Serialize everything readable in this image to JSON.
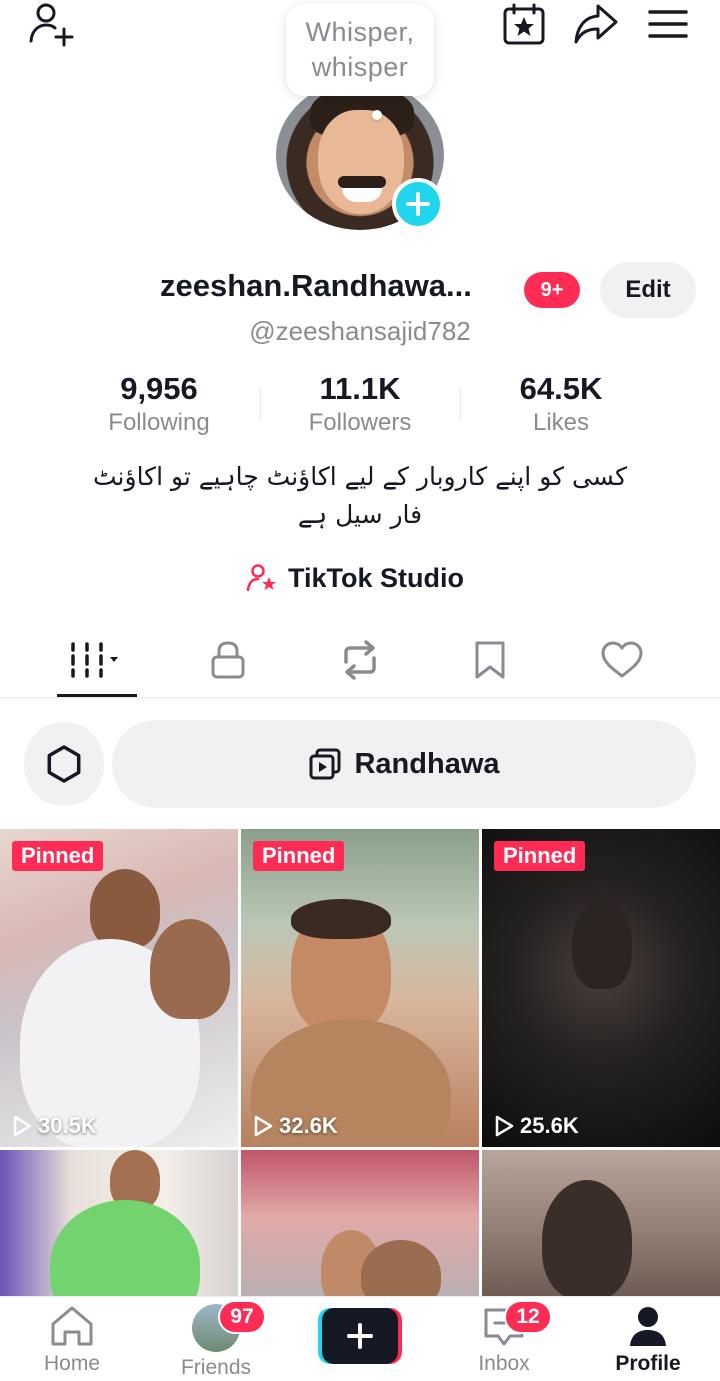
{
  "header": {
    "icons": [
      "add-friend-icon",
      "creator-calendar-icon",
      "share-icon",
      "menu-icon"
    ]
  },
  "bubble": {
    "line1": "Whisper,",
    "line2": "whisper"
  },
  "profile": {
    "display_name": "zeeshan.Randhawa...",
    "notification_badge": "9+",
    "edit_label": "Edit",
    "username": "@zeeshansajid782",
    "bio_line1": "کسی کو اپنے کاروبار کے لیے اکاؤنٹ چاہیے تو اکاؤنٹ",
    "bio_line2": "فار سیل ہے",
    "studio_label": "TikTok Studio"
  },
  "stats": {
    "following": {
      "value": "9,956",
      "label": "Following"
    },
    "followers": {
      "value": "11.1K",
      "label": "Followers"
    },
    "likes": {
      "value": "64.5K",
      "label": "Likes"
    }
  },
  "tabs": [
    "videos",
    "private",
    "reposts",
    "saved",
    "liked"
  ],
  "collection": {
    "label": "Randhawa"
  },
  "videos": [
    {
      "pinned_label": "Pinned",
      "views": "30.5K"
    },
    {
      "pinned_label": "Pinned",
      "views": "32.6K"
    },
    {
      "pinned_label": "Pinned",
      "views": "25.6K"
    },
    {
      "pinned_label": "",
      "views": ""
    },
    {
      "pinned_label": "",
      "views": ""
    },
    {
      "pinned_label": "",
      "views": ""
    }
  ],
  "bottom_nav": {
    "home": "Home",
    "friends": "Friends",
    "friends_badge": "97",
    "inbox": "Inbox",
    "inbox_badge": "12",
    "profile": "Profile"
  },
  "colors": {
    "accent": "#fe2c55",
    "cyan": "#20d5ec",
    "text": "#161823",
    "muted": "#8a8b91"
  }
}
